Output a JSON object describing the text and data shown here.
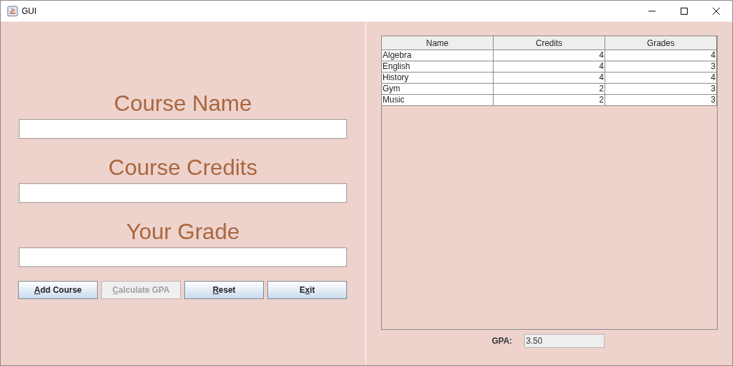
{
  "window": {
    "title": "GUI"
  },
  "form": {
    "fields": [
      {
        "label": "Course Name"
      },
      {
        "label": "Course Credits"
      },
      {
        "label": "Your Grade"
      }
    ],
    "buttons": [
      {
        "parts": [
          {
            "text": "A",
            "underlined": true
          },
          {
            "text": "dd Course",
            "underlined": false
          }
        ],
        "disabled": false
      },
      {
        "parts": [
          {
            "text": "C",
            "underlined": true
          },
          {
            "text": "alculate GPA",
            "underlined": false
          }
        ],
        "disabled": true
      },
      {
        "parts": [
          {
            "text": "R",
            "underlined": true
          },
          {
            "text": "eset",
            "underlined": false
          }
        ],
        "disabled": false
      },
      {
        "parts": [
          {
            "text": "E",
            "underlined": false
          },
          {
            "text": "x",
            "underlined": true
          },
          {
            "text": "it",
            "underlined": false
          }
        ],
        "disabled": false
      }
    ]
  },
  "table": {
    "columns": [
      "Name",
      "Credits",
      "Grades"
    ],
    "rows": [
      [
        "Algebra",
        "4",
        "4"
      ],
      [
        "English",
        "4",
        "3"
      ],
      [
        "History",
        "4",
        "4"
      ],
      [
        "Gym",
        "2",
        "3"
      ],
      [
        "Music",
        "2",
        "3"
      ]
    ]
  },
  "gpa": {
    "label": "GPA:",
    "value": "3.50"
  }
}
